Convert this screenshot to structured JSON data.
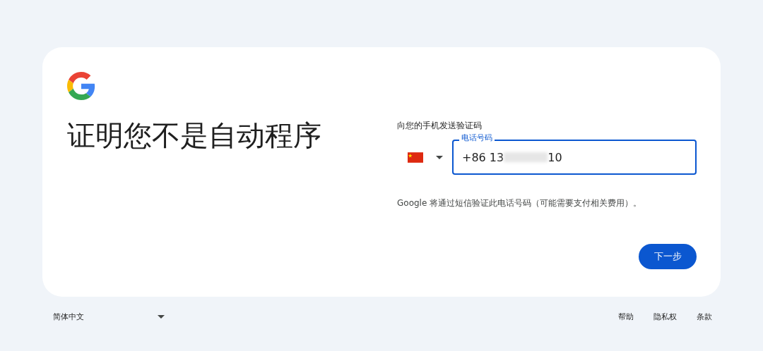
{
  "card": {
    "title": "证明您不是自动程序",
    "prompt": "向您的手机发送验证码",
    "phone_field": {
      "label": "电话号码",
      "value_start": "+86 13",
      "redacted": true,
      "value_end": "10",
      "focused": true
    },
    "notice": "Google 将通过短信验证此电话号码（可能需要支付相关费用）。",
    "next_button": "下一步"
  },
  "footer": {
    "language": "简体中文",
    "links": [
      "帮助",
      "隐私权",
      "条款"
    ]
  }
}
